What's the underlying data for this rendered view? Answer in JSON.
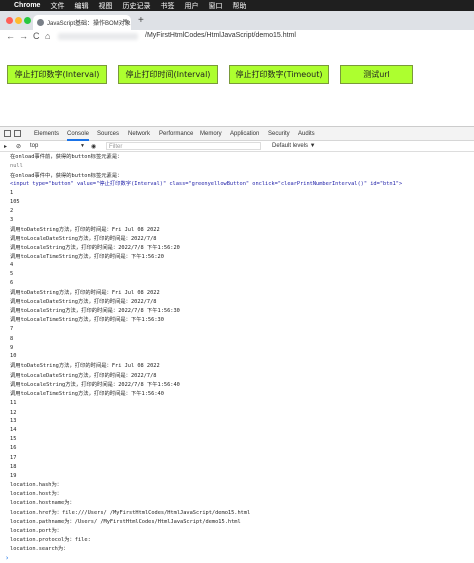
{
  "menubar": {
    "apple": "",
    "items": [
      "Chrome",
      "文件",
      "编辑",
      "视图",
      "历史记录",
      "书签",
      "用户",
      "窗口",
      "帮助"
    ]
  },
  "tab": {
    "title": "JavaScript基础：操作BOM对象",
    "close": "×",
    "newtab": "+"
  },
  "toolbar": {
    "back": "←",
    "forward": "→",
    "reload": "C",
    "home": "⌂",
    "url": "/MyFirstHtmlCodes/HtmlJavaScript/demo15.html"
  },
  "page": {
    "buttons": [
      "停止打印数字(Interval)",
      "停止打印时间(Interval)",
      "停止打印数字(Timeout)",
      "测试url"
    ]
  },
  "devtools": {
    "tabs": [
      "Elements",
      "Console",
      "Sources",
      "Network",
      "Performance",
      "Memory",
      "Application",
      "Security",
      "Audits"
    ],
    "context": "top",
    "context_arrow": "▼",
    "filter_placeholder": "Filter",
    "levels": "Default levels ▼"
  },
  "console": {
    "lines": [
      "在onload事件前，获得的button标签元素是：",
      "null",
      "在onload事件中，获得的button标签元素是：",
      "  <input type=\"button\" value=\"停止打印数字(Interval)\" class=\"greenyellowButton\" onclick=\"clearPrintNumberInterval()\" id=\"btn1\">",
      "1",
      "105",
      "2",
      "3",
      "调用toDateString方法，打印的时间是：Fri Jul 08 2022",
      "调用toLocaleDateString方法，打印的时间是：2022/7/8",
      "调用toLocaleString方法，打印的时间是：2022/7/8 下午1:56:20",
      "调用toLocaleTimeString方法，打印的时间是：下午1:56:20",
      "4",
      "5",
      "6",
      "调用toDateString方法，打印的时间是：Fri Jul 08 2022",
      "调用toLocaleDateString方法，打印的时间是：2022/7/8",
      "调用toLocaleString方法，打印的时间是：2022/7/8 下午1:56:30",
      "调用toLocaleTimeString方法，打印的时间是：下午1:56:30",
      "7",
      "8",
      "9",
      "10",
      "调用toDateString方法，打印的时间是：Fri Jul 08 2022",
      "调用toLocaleDateString方法，打印的时间是：2022/7/8",
      "调用toLocaleString方法，打印的时间是：2022/7/8 下午1:56:40",
      "调用toLocaleTimeString方法，打印的时间是：下午1:56:40",
      "11",
      "12",
      "13",
      "14",
      "15",
      "16",
      "17",
      "18",
      "19",
      "location.hash为：",
      "location.host为：",
      "location.hostname为：",
      "location.href为：file:///Users/      /MyFirstHtmlCodes/HtmlJavaScript/demo15.html",
      "location.pathname为：/Users/      /MyFirstHtmlCodes/HtmlJavaScript/demo15.html",
      "location.port为：",
      "location.protocol为：file:",
      "location.search为："
    ],
    "prompt": "›"
  },
  "colors": {
    "button_bg": "#adff2f",
    "button_border": "#7a9a3a",
    "active_tab": "#1a73e8"
  }
}
